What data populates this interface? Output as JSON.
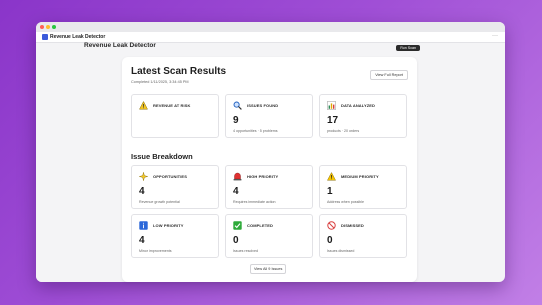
{
  "window": {
    "app_title": "Revenue Leak Detector",
    "menu_icon": "more-icon"
  },
  "header": {
    "title": "Revenue Leak Detector",
    "run_scan_label": "Run Scan"
  },
  "scan": {
    "title": "Latest Scan Results",
    "completed": "Completed 1/11/2025, 3:34:45 PM",
    "full_report_label": "View Full Report"
  },
  "summary": [
    {
      "label": "REVENUE AT RISK",
      "value": "",
      "sub": "",
      "icon": "warning-coins-icon",
      "color": "#d9a400"
    },
    {
      "label": "ISSUES FOUND",
      "value": "9",
      "sub": "4 opportunities · 5 problems",
      "icon": "magnifier-icon",
      "color": "#1f5fbf"
    },
    {
      "label": "DATA ANALYZED",
      "value": "17",
      "sub": "products · 20 orders",
      "icon": "bar-chart-icon",
      "color": "#2e8b57"
    }
  ],
  "breakdown": {
    "title": "Issue Breakdown",
    "items": [
      {
        "label": "OPPORTUNITIES",
        "value": "4",
        "sub": "Revenue growth potential",
        "icon": "sparkle-icon",
        "color": "#e0a800"
      },
      {
        "label": "HIGH PRIORITY",
        "value": "4",
        "sub": "Requires immediate action",
        "icon": "siren-icon",
        "color": "#d92b2b"
      },
      {
        "label": "MEDIUM PRIORITY",
        "value": "1",
        "sub": "Address when possible",
        "icon": "warning-icon",
        "color": "#f0c000"
      },
      {
        "label": "LOW PRIORITY",
        "value": "4",
        "sub": "Minor improvements",
        "icon": "info-icon",
        "color": "#2b67d9"
      },
      {
        "label": "COMPLETED",
        "value": "0",
        "sub": "Issues resolved",
        "icon": "check-icon",
        "color": "#2eaa3a"
      },
      {
        "label": "DISMISSED",
        "value": "0",
        "sub": "Issues dismissed",
        "icon": "no-entry-icon",
        "color": "#d94040"
      }
    ],
    "view_all_label": "View All 9 Issues"
  }
}
